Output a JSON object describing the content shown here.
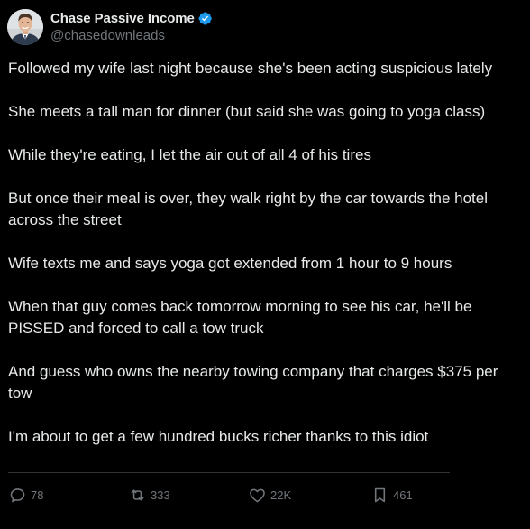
{
  "author": {
    "display_name": "Chase Passive Income",
    "handle": "@chasedownleads",
    "verified": true,
    "verified_color": "#1d9bf0"
  },
  "tweet": {
    "paragraphs": [
      "Followed my wife last night because she's been acting suspicious lately",
      "She meets a tall man for dinner (but said she was going to yoga class)",
      "While they're eating, I let the air out of all 4 of his tires",
      "But once their meal is over, they walk right by the car towards the hotel across the street",
      "Wife texts me and says yoga got extended from 1 hour to 9 hours",
      "When that guy comes back tomorrow morning to see his car, he'll be PISSED and forced to call a tow truck",
      "And guess who owns the nearby towing company that charges $375 per tow",
      "I'm about to get a few hundred bucks richer thanks to this idiot"
    ]
  },
  "actions": {
    "replies": "78",
    "reposts": "333",
    "likes": "22K",
    "bookmarks": "461",
    "icons": {
      "reply": "reply-icon",
      "repost": "repost-icon",
      "like": "heart-icon",
      "bookmark": "bookmark-icon"
    }
  },
  "colors": {
    "background": "#000000",
    "text": "#e7e9ea",
    "secondary": "#71767b",
    "divider": "#2f3336"
  }
}
